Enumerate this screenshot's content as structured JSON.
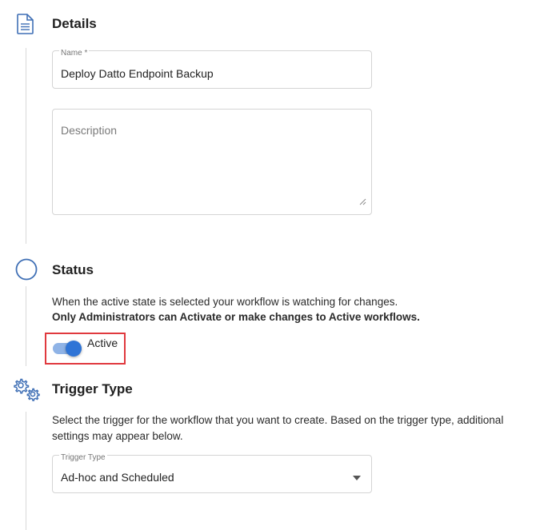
{
  "details": {
    "title": "Details",
    "name_label": "Name *",
    "name_value": "Deploy Datto Endpoint Backup",
    "description_placeholder": "Description"
  },
  "status": {
    "title": "Status",
    "line1": "When the active state is selected your workflow is watching for changes.",
    "line2": "Only Administrators can Activate or make changes to Active workflows.",
    "toggle_label": "Active",
    "toggle_on": true
  },
  "trigger": {
    "title": "Trigger Type",
    "line1": "Select the trigger for the workflow that you want to create. Based on the trigger type, additional",
    "line2": "settings may appear below.",
    "select_label": "Trigger Type",
    "select_value": "Ad-hoc and Scheduled"
  },
  "icons": {
    "details": "document-icon",
    "status": "circle-icon",
    "trigger": "gears-icon",
    "dropdown": "caret-down-icon",
    "resize": "resize-handle-icon"
  },
  "colors": {
    "icon_blue": "#3f6fb5",
    "toggle_on": "#2f74d6",
    "toggle_track": "#8fb3e6",
    "highlight": "#e0393e"
  }
}
